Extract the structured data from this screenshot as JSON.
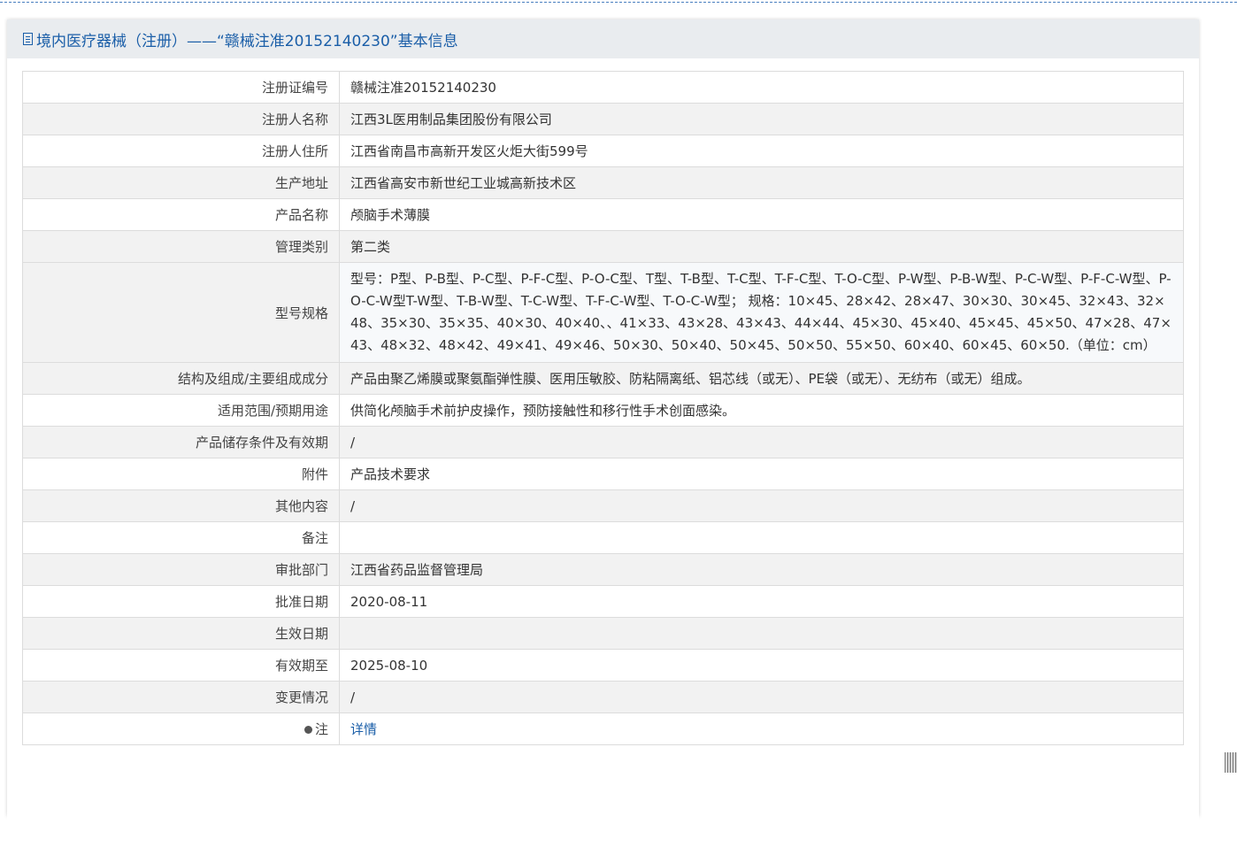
{
  "header": {
    "title": "境内医疗器械（注册）——“赣械注准20152140230”基本信息"
  },
  "rows": [
    {
      "label": "注册证编号",
      "value": "赣械注准20152140230"
    },
    {
      "label": "注册人名称",
      "value": "江西3L医用制品集团股份有限公司"
    },
    {
      "label": "注册人住所",
      "value": "江西省南昌市高新开发区火炬大街599号"
    },
    {
      "label": "生产地址",
      "value": "江西省高安市新世纪工业城高新技术区"
    },
    {
      "label": "产品名称",
      "value": "颅脑手术薄膜"
    },
    {
      "label": "管理类别",
      "value": "第二类"
    },
    {
      "label": "型号规格",
      "value": "型号：P型、P-B型、P-C型、P-F-C型、P-O-C型、T型、T-B型、T-C型、T-F-C型、T-O-C型、P-W型、P-B-W型、P-C-W型、P-F-C-W型、P-O-C-W型T-W型、T-B-W型、T-C-W型、T-F-C-W型、T-O-C-W型； 规格：10×45、28×42、28×47、30×30、30×45、32×43、32×48、35×30、35×35、40×30、40×40、、41×33、43×28、43×43、44×44、45×30、45×40、45×45、45×50、47×28、47×43、48×32、48×42、49×41、49×46、50×30、50×40、50×45、50×50、55×50、60×40、60×45、60×50.（单位：cm）"
    },
    {
      "label": "结构及组成/主要组成成分",
      "value": "产品由聚乙烯膜或聚氨酯弹性膜、医用压敏胶、防粘隔离纸、铝芯线（或无）、PE袋（或无）、无纺布（或无）组成。"
    },
    {
      "label": "适用范围/预期用途",
      "value": "供简化颅脑手术前护皮操作，预防接触性和移行性手术创面感染。"
    },
    {
      "label": "产品储存条件及有效期",
      "value": "/"
    },
    {
      "label": "附件",
      "value": "产品技术要求"
    },
    {
      "label": "其他内容",
      "value": "/"
    },
    {
      "label": "备注",
      "value": ""
    },
    {
      "label": "审批部门",
      "value": "江西省药品监督管理局"
    },
    {
      "label": "批准日期",
      "value": "2020-08-11"
    },
    {
      "label": "生效日期",
      "value": ""
    },
    {
      "label": "有效期至",
      "value": "2025-08-10"
    },
    {
      "label": "变更情况",
      "value": "/"
    },
    {
      "label": "注",
      "value": "详情"
    }
  ]
}
